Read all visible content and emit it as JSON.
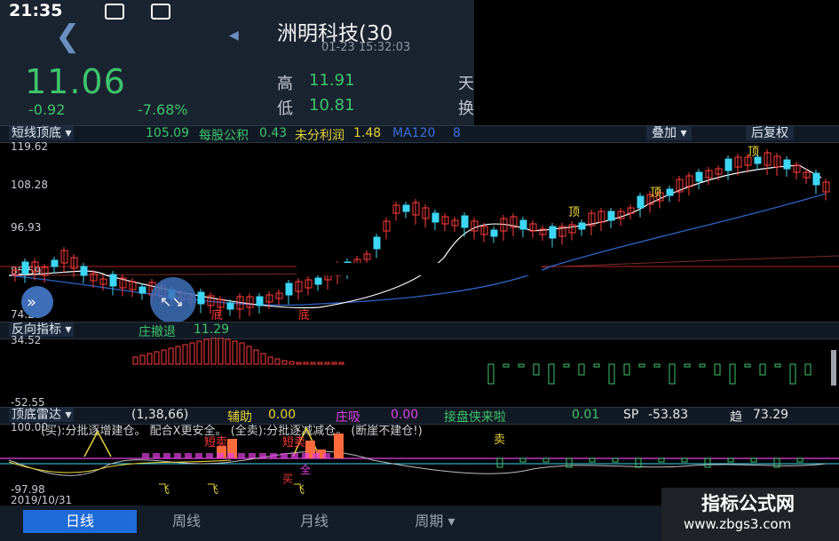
{
  "status": {
    "time": "21:35"
  },
  "header": {
    "stock_name": "洲明科技(30",
    "time": "01-23 15:32:03",
    "price": "11.06",
    "change": "-0.92",
    "change_pct": "-7.68%",
    "high_label": "高",
    "high_value": "11.91",
    "low_label": "低",
    "low_value": "10.81",
    "cut1": "天",
    "cut2": "换"
  },
  "main_bar": {
    "dropdown": "短线顶底",
    "v1": "105.09",
    "v2_label": "每股公积",
    "v2": "0.43",
    "v3_label": "未分利润",
    "v3": "1.48",
    "v4_label": "MA120",
    "v4": "8",
    "btn_overlay": "叠加",
    "btn_adjust": "后复权"
  },
  "main_axis": {
    "t1": "119.62",
    "t2": "108.28",
    "t3": "96.93",
    "t4": "85.59",
    "t5": "74.24"
  },
  "main_labels": {
    "top": "顶",
    "bottom": "底"
  },
  "ind2": {
    "dropdown": "反向指标",
    "label": "庄撤退",
    "value": "11.29",
    "ymax": "34.52",
    "ymin": "-52.55"
  },
  "ind3": {
    "dropdown": "顶底雷达",
    "params": "(1,38,66)",
    "a_label": "辅助",
    "a": "0.00",
    "b_label": "庄吸",
    "b": "0.00",
    "c_label": "接盘侠来啦",
    "c": "0.01",
    "d_label": "SP",
    "d": "-53.83",
    "e_label": "趋",
    "e": "73.29",
    "ymax": "100.00",
    "ymin": "-97.98",
    "date": "2019/10/31",
    "note": "(买):分批逐增建仓。  配合X更安全。  (全卖):分批逐减减仓。  (断崖不建仓!)",
    "marks": {
      "fly": "飞",
      "buy": "买",
      "sell": "卖",
      "short_sell": "短卖",
      "all": "全"
    }
  },
  "tabs": [
    {
      "label": "日线"
    },
    {
      "label": "周线"
    },
    {
      "label": "月线"
    },
    {
      "label": "周期"
    }
  ],
  "watermark": {
    "line1": "指标公式网",
    "line2": "www.zbgs3.com"
  },
  "colors": {
    "up": "#ff3b3b",
    "down": "#3ec46d",
    "cyan": "#3dd6f5",
    "yellow": "#f5e13d",
    "magenta": "#e23fe2"
  }
}
